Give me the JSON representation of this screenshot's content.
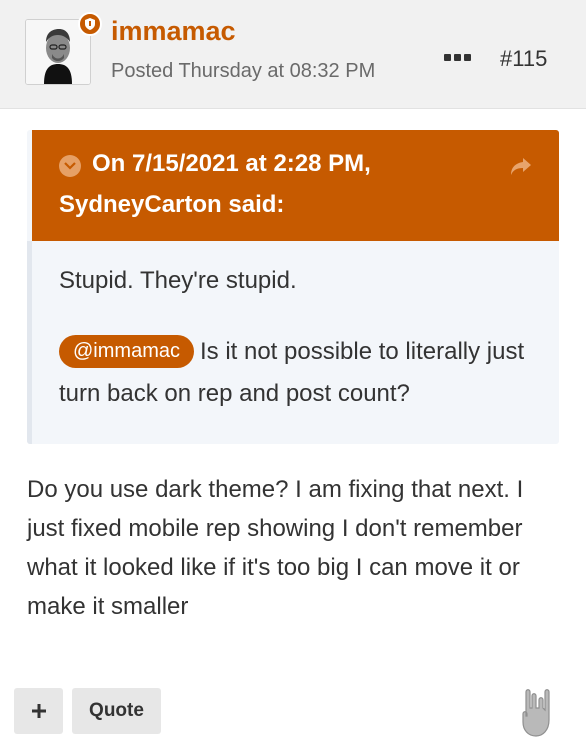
{
  "post": {
    "username": "immamac",
    "posted": "Posted Thursday at 08:32 PM",
    "number": "#115",
    "avatar_icon": "user-avatar",
    "badge_icon": "shield-icon"
  },
  "quote": {
    "header_line1": "On 7/15/2021 at 2:28 PM,",
    "header_line2": "SydneyCarton said:",
    "paragraph1": "Stupid. They're stupid.",
    "mention": "@immamac",
    "paragraph2": "Is it not possible to literally just turn back on rep and post count?"
  },
  "content": "Do you use dark theme? I am fixing that next. I just fixed mobile rep showing I don't remember what it looked like if it's too big I can move it or make it smaller",
  "actions": {
    "plus_label": "+",
    "quote_label": "Quote"
  },
  "colors": {
    "accent": "#c65a00",
    "header_bg": "#f1f1f1",
    "quote_bg": "#f3f6fa"
  }
}
